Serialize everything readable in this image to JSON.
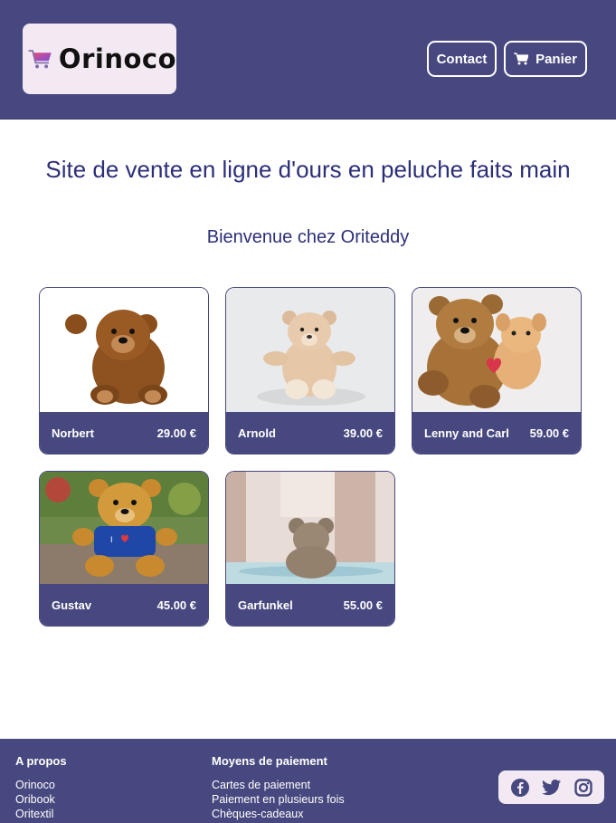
{
  "header": {
    "logo_text": "Orinoco",
    "nav": {
      "contact_label": "Contact",
      "panier_label": "Panier"
    }
  },
  "main": {
    "title": "Site de vente en ligne d'ours en peluche faits main",
    "welcome": "Bienvenue chez Oriteddy",
    "products": [
      {
        "name": "Norbert",
        "price": "29.00 €"
      },
      {
        "name": "Arnold",
        "price": "39.00 €"
      },
      {
        "name": "Lenny and Carl",
        "price": "59.00 €"
      },
      {
        "name": "Gustav",
        "price": "45.00 €"
      },
      {
        "name": "Garfunkel",
        "price": "55.00 €"
      }
    ]
  },
  "footer": {
    "about": {
      "heading": "A propos",
      "items": [
        "Orinoco",
        "Oribook",
        "Oritextil"
      ]
    },
    "payment": {
      "heading": "Moyens de paiement",
      "items": [
        "Cartes de paiement",
        "Paiement en plusieurs fois",
        "Chèques-cadeaux"
      ]
    },
    "social_icons": [
      "facebook-icon",
      "twitter-icon",
      "instagram-icon"
    ]
  },
  "colors": {
    "brand": "#47487f",
    "title": "#2c2f78",
    "logo_bg": "#f3e9f3"
  }
}
